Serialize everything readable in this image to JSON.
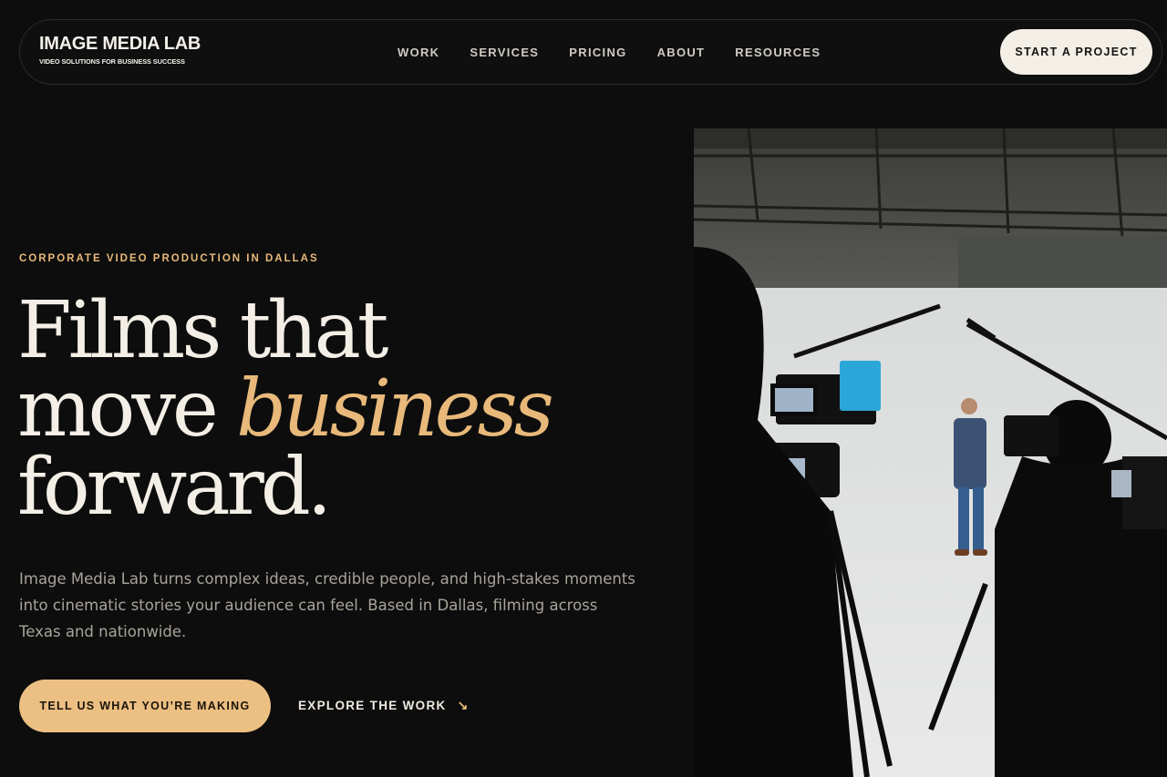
{
  "nav": {
    "logo": {
      "title": "IMAGE MEDIA LAB",
      "tagline": "VIDEO SOLUTIONS FOR BUSINESS SUCCESS"
    },
    "links": [
      "WORK",
      "SERVICES",
      "PRICING",
      "ABOUT",
      "RESOURCES"
    ],
    "cta_label": "START A PROJECT"
  },
  "hero": {
    "eyebrow": "CORPORATE VIDEO PRODUCTION IN DALLAS",
    "headline": {
      "line1": "Films that",
      "line2_start": "move ",
      "line2_accent": "business",
      "line3": "forward."
    },
    "lede": "Image Media Lab turns complex ideas, credible people, and high-stakes moments into cinematic stories your audience can feel. Based in Dallas, filming across Texas and nationwide.",
    "primary_cta_label": "TELL US WHAT YOU’RE MAKING",
    "secondary_cta_label": "EXPLORE THE WORK",
    "secondary_cta_icon": "arrow-down-right-icon",
    "arrow_glyph": "↘"
  },
  "colors": {
    "background": "#0d0d0d",
    "accent": "#e8b97a",
    "primary_button": "#ecbf83",
    "light_button": "#f3eee6",
    "text": "#f4efe6",
    "muted_text": "#a9a49b"
  }
}
